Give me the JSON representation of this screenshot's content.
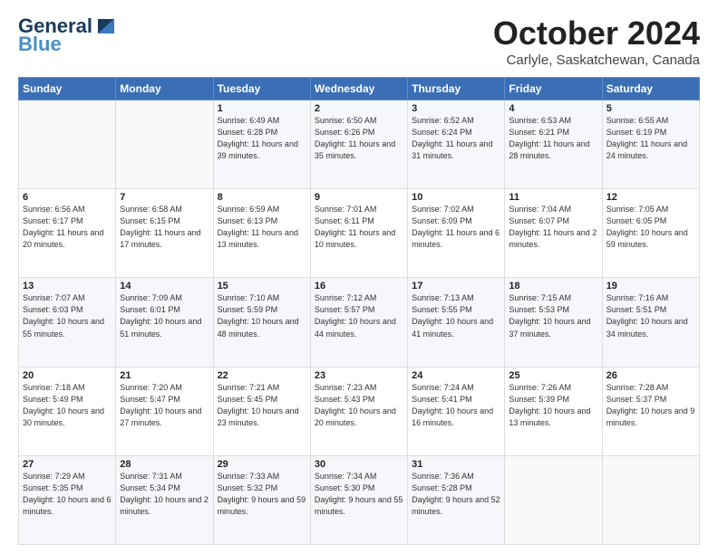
{
  "header": {
    "logo_line1": "General",
    "logo_line2": "Blue",
    "month": "October 2024",
    "location": "Carlyle, Saskatchewan, Canada"
  },
  "days_of_week": [
    "Sunday",
    "Monday",
    "Tuesday",
    "Wednesday",
    "Thursday",
    "Friday",
    "Saturday"
  ],
  "weeks": [
    [
      {
        "num": "",
        "sunrise": "",
        "sunset": "",
        "daylight": ""
      },
      {
        "num": "",
        "sunrise": "",
        "sunset": "",
        "daylight": ""
      },
      {
        "num": "1",
        "sunrise": "Sunrise: 6:49 AM",
        "sunset": "Sunset: 6:28 PM",
        "daylight": "Daylight: 11 hours and 39 minutes."
      },
      {
        "num": "2",
        "sunrise": "Sunrise: 6:50 AM",
        "sunset": "Sunset: 6:26 PM",
        "daylight": "Daylight: 11 hours and 35 minutes."
      },
      {
        "num": "3",
        "sunrise": "Sunrise: 6:52 AM",
        "sunset": "Sunset: 6:24 PM",
        "daylight": "Daylight: 11 hours and 31 minutes."
      },
      {
        "num": "4",
        "sunrise": "Sunrise: 6:53 AM",
        "sunset": "Sunset: 6:21 PM",
        "daylight": "Daylight: 11 hours and 28 minutes."
      },
      {
        "num": "5",
        "sunrise": "Sunrise: 6:55 AM",
        "sunset": "Sunset: 6:19 PM",
        "daylight": "Daylight: 11 hours and 24 minutes."
      }
    ],
    [
      {
        "num": "6",
        "sunrise": "Sunrise: 6:56 AM",
        "sunset": "Sunset: 6:17 PM",
        "daylight": "Daylight: 11 hours and 20 minutes."
      },
      {
        "num": "7",
        "sunrise": "Sunrise: 6:58 AM",
        "sunset": "Sunset: 6:15 PM",
        "daylight": "Daylight: 11 hours and 17 minutes."
      },
      {
        "num": "8",
        "sunrise": "Sunrise: 6:59 AM",
        "sunset": "Sunset: 6:13 PM",
        "daylight": "Daylight: 11 hours and 13 minutes."
      },
      {
        "num": "9",
        "sunrise": "Sunrise: 7:01 AM",
        "sunset": "Sunset: 6:11 PM",
        "daylight": "Daylight: 11 hours and 10 minutes."
      },
      {
        "num": "10",
        "sunrise": "Sunrise: 7:02 AM",
        "sunset": "Sunset: 6:09 PM",
        "daylight": "Daylight: 11 hours and 6 minutes."
      },
      {
        "num": "11",
        "sunrise": "Sunrise: 7:04 AM",
        "sunset": "Sunset: 6:07 PM",
        "daylight": "Daylight: 11 hours and 2 minutes."
      },
      {
        "num": "12",
        "sunrise": "Sunrise: 7:05 AM",
        "sunset": "Sunset: 6:05 PM",
        "daylight": "Daylight: 10 hours and 59 minutes."
      }
    ],
    [
      {
        "num": "13",
        "sunrise": "Sunrise: 7:07 AM",
        "sunset": "Sunset: 6:03 PM",
        "daylight": "Daylight: 10 hours and 55 minutes."
      },
      {
        "num": "14",
        "sunrise": "Sunrise: 7:09 AM",
        "sunset": "Sunset: 6:01 PM",
        "daylight": "Daylight: 10 hours and 51 minutes."
      },
      {
        "num": "15",
        "sunrise": "Sunrise: 7:10 AM",
        "sunset": "Sunset: 5:59 PM",
        "daylight": "Daylight: 10 hours and 48 minutes."
      },
      {
        "num": "16",
        "sunrise": "Sunrise: 7:12 AM",
        "sunset": "Sunset: 5:57 PM",
        "daylight": "Daylight: 10 hours and 44 minutes."
      },
      {
        "num": "17",
        "sunrise": "Sunrise: 7:13 AM",
        "sunset": "Sunset: 5:55 PM",
        "daylight": "Daylight: 10 hours and 41 minutes."
      },
      {
        "num": "18",
        "sunrise": "Sunrise: 7:15 AM",
        "sunset": "Sunset: 5:53 PM",
        "daylight": "Daylight: 10 hours and 37 minutes."
      },
      {
        "num": "19",
        "sunrise": "Sunrise: 7:16 AM",
        "sunset": "Sunset: 5:51 PM",
        "daylight": "Daylight: 10 hours and 34 minutes."
      }
    ],
    [
      {
        "num": "20",
        "sunrise": "Sunrise: 7:18 AM",
        "sunset": "Sunset: 5:49 PM",
        "daylight": "Daylight: 10 hours and 30 minutes."
      },
      {
        "num": "21",
        "sunrise": "Sunrise: 7:20 AM",
        "sunset": "Sunset: 5:47 PM",
        "daylight": "Daylight: 10 hours and 27 minutes."
      },
      {
        "num": "22",
        "sunrise": "Sunrise: 7:21 AM",
        "sunset": "Sunset: 5:45 PM",
        "daylight": "Daylight: 10 hours and 23 minutes."
      },
      {
        "num": "23",
        "sunrise": "Sunrise: 7:23 AM",
        "sunset": "Sunset: 5:43 PM",
        "daylight": "Daylight: 10 hours and 20 minutes."
      },
      {
        "num": "24",
        "sunrise": "Sunrise: 7:24 AM",
        "sunset": "Sunset: 5:41 PM",
        "daylight": "Daylight: 10 hours and 16 minutes."
      },
      {
        "num": "25",
        "sunrise": "Sunrise: 7:26 AM",
        "sunset": "Sunset: 5:39 PM",
        "daylight": "Daylight: 10 hours and 13 minutes."
      },
      {
        "num": "26",
        "sunrise": "Sunrise: 7:28 AM",
        "sunset": "Sunset: 5:37 PM",
        "daylight": "Daylight: 10 hours and 9 minutes."
      }
    ],
    [
      {
        "num": "27",
        "sunrise": "Sunrise: 7:29 AM",
        "sunset": "Sunset: 5:35 PM",
        "daylight": "Daylight: 10 hours and 6 minutes."
      },
      {
        "num": "28",
        "sunrise": "Sunrise: 7:31 AM",
        "sunset": "Sunset: 5:34 PM",
        "daylight": "Daylight: 10 hours and 2 minutes."
      },
      {
        "num": "29",
        "sunrise": "Sunrise: 7:33 AM",
        "sunset": "Sunset: 5:32 PM",
        "daylight": "Daylight: 9 hours and 59 minutes."
      },
      {
        "num": "30",
        "sunrise": "Sunrise: 7:34 AM",
        "sunset": "Sunset: 5:30 PM",
        "daylight": "Daylight: 9 hours and 55 minutes."
      },
      {
        "num": "31",
        "sunrise": "Sunrise: 7:36 AM",
        "sunset": "Sunset: 5:28 PM",
        "daylight": "Daylight: 9 hours and 52 minutes."
      },
      {
        "num": "",
        "sunrise": "",
        "sunset": "",
        "daylight": ""
      },
      {
        "num": "",
        "sunrise": "",
        "sunset": "",
        "daylight": ""
      }
    ]
  ]
}
